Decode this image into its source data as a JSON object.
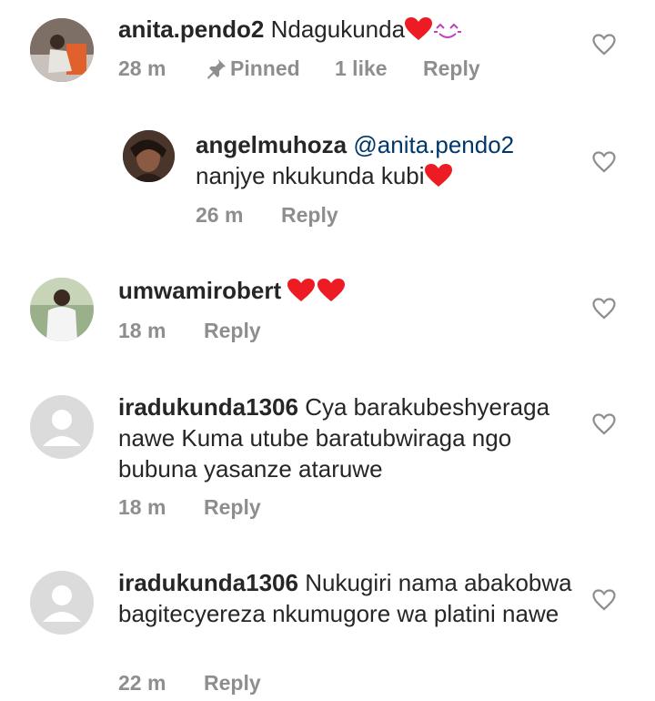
{
  "comments": [
    {
      "username": "anita.pendo2",
      "text": "Ndagukunda",
      "time": "28 m",
      "pinned": "Pinned",
      "likes": "1 like",
      "reply": "Reply"
    },
    {
      "username": "angelmuhoza",
      "mention": "@anita.pendo2",
      "text": "nanjye nkukunda kubi",
      "time": "26 m",
      "reply": "Reply"
    },
    {
      "username": "umwamirobert",
      "text": "",
      "time": "18 m",
      "reply": "Reply"
    },
    {
      "username": "iradukunda1306",
      "text": "Cya barakubeshyeraga nawe Kuma utube baratubwiraga ngo bubuna yasanze ataruwe",
      "time": "18 m",
      "reply": "Reply"
    },
    {
      "username": "iradukunda1306",
      "text": "Nukugiri nama abakobwa bagitecyereza nkumugore wa platini nawe",
      "time": "22 m",
      "reply": "Reply"
    }
  ],
  "icons": {
    "like": "heart-outline-icon",
    "pin": "pin-icon",
    "emoji_heart": "red-heart-emoji",
    "emoji_face": "smiling-face-emoji"
  },
  "colors": {
    "text": "#262626",
    "meta": "#8e8e8e",
    "mention": "#00376b",
    "heart": "#ed1c24"
  }
}
